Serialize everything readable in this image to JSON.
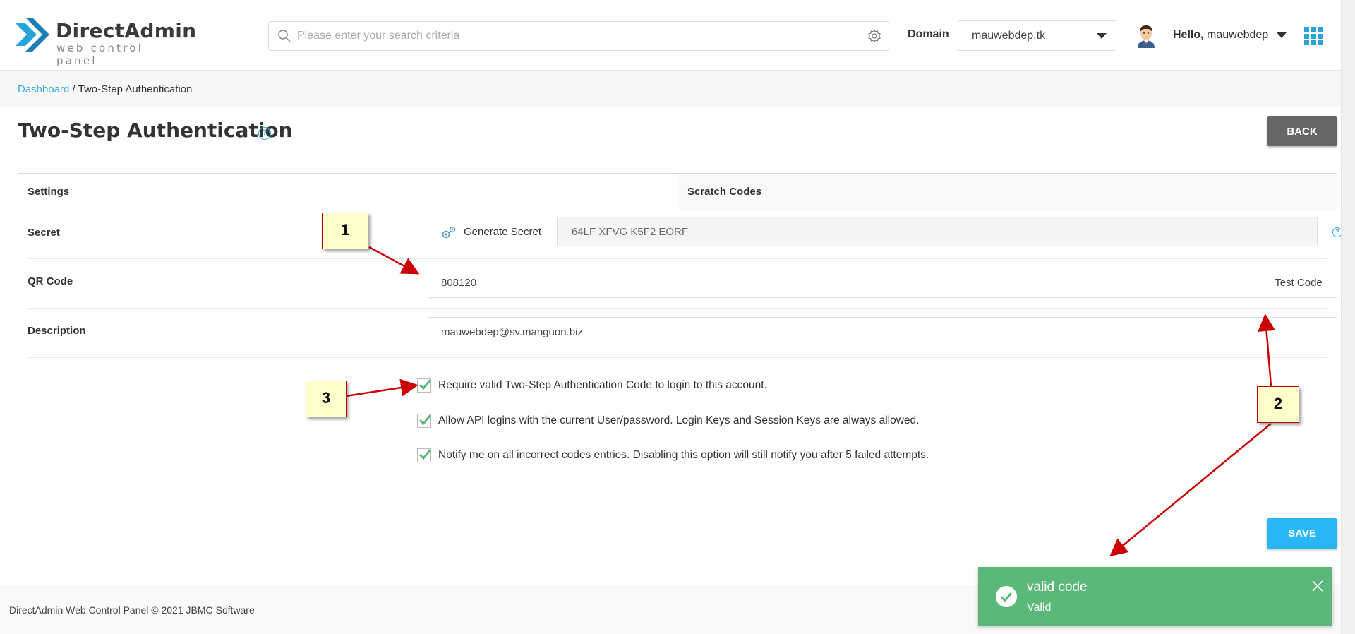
{
  "header": {
    "logo_name": "DirectAdmin",
    "logo_tagline": "web control panel",
    "search_placeholder": "Please enter your search criteria",
    "domain_label": "Domain",
    "domain_value": "mauwebdep.tk",
    "hello_prefix": "Hello,",
    "username": "mauwebdep"
  },
  "breadcrumb": {
    "home": "Dashboard",
    "separator": " / ",
    "current": "Two-Step Authentication"
  },
  "page": {
    "title": "Two-Step Authentication",
    "help_glyph": "?",
    "back_label": "BACK",
    "save_label": "SAVE"
  },
  "tabs": {
    "settings": "Settings",
    "scratch": "Scratch Codes"
  },
  "form": {
    "secret_label": "Secret",
    "generate_label": "Generate Secret",
    "secret_value": "64LF XFVG K5F2 EORF",
    "qr_label": "QR Code",
    "qr_value": "808120",
    "test_label": "Test Code",
    "description_label": "Description",
    "description_value": "mauwebdep@sv.manguon.biz",
    "checks": [
      {
        "label": "Require valid Two-Step Authentication Code to login to this account.",
        "checked": true
      },
      {
        "label": "Allow API logins with the current User/password. Login Keys and Session Keys are always allowed.",
        "checked": true
      },
      {
        "label": "Notify me on all incorrect codes entries. Disabling this option will still notify you after 5 failed attempts.",
        "checked": true
      }
    ]
  },
  "footer": {
    "text": "DirectAdmin Web Control Panel © 2021 JBMC Software"
  },
  "toast": {
    "title": "valid code",
    "message": "Valid"
  },
  "annotations": [
    "1",
    "2",
    "3"
  ],
  "colors": {
    "accent": "#36a9e1",
    "success": "#5cb87a",
    "check_green": "#5cb87a",
    "save_button": "#29b6f6",
    "back_button": "#666666",
    "annotation_arrow": "#cc0000"
  },
  "icons": {
    "search": "search-icon",
    "gear": "gear-icon",
    "apps": "apps-grid-icon",
    "generate": "gears-icon",
    "toast": "check-circle-icon",
    "close": "close-icon"
  }
}
